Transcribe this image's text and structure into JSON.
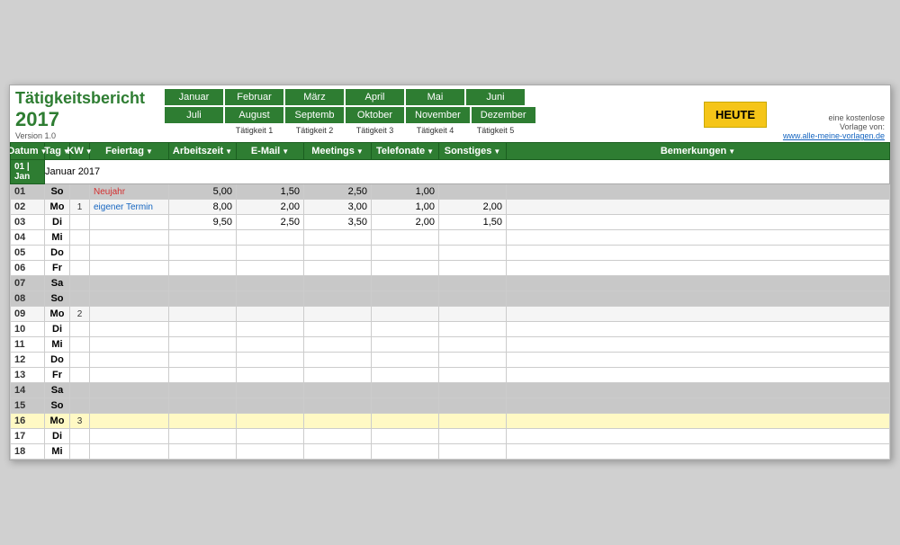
{
  "header": {
    "title": "Tätigkeitsbericht",
    "year": "2017",
    "version": "Version 1.0",
    "heute_label": "HEUTE",
    "right_line1": "eine kostenlose",
    "right_line2": "Vorlage von:",
    "right_link": "www.alle-meine-vorlagen.de"
  },
  "months_row1": [
    "Januar",
    "Februar",
    "März",
    "April",
    "Mai",
    "Juni"
  ],
  "months_row2": [
    "Juli",
    "August",
    "Septemb",
    "Oktober",
    "November",
    "Dezember"
  ],
  "taetigkeit_row1": [
    "Tätigkeit 1",
    "Tätigkeit 2",
    "Tätigkeit 3",
    "Tätigkeit 4",
    "Tätigkeit 5"
  ],
  "column_headers": {
    "datum": "Datum",
    "tag": "Tag",
    "kw": "KW",
    "feiertag": "Feiertag",
    "arbeitszeit": "Arbeitszeit",
    "email": "E-Mail",
    "meetings": "Meetings",
    "telefonate": "Telefonate",
    "sonstiges": "Sonstiges",
    "bemerkungen": "Bemerkungen"
  },
  "month_title": "Januar 2017",
  "month_prefix": "01 | Jan",
  "rows": [
    {
      "datum": "01",
      "tag": "So",
      "kw": "",
      "feiertag": "Neujahr",
      "feiertag_type": "holiday",
      "arbeitszeit": "5,00",
      "email": "1,50",
      "meetings": "2,50",
      "telefonate": "1,00",
      "sonstiges": "",
      "bemerkungen": "",
      "row_type": "weekend"
    },
    {
      "datum": "02",
      "tag": "Mo",
      "kw": "1",
      "feiertag": "eigener Termin",
      "feiertag_type": "eigener",
      "arbeitszeit": "8,00",
      "email": "2,00",
      "meetings": "3,00",
      "telefonate": "1,00",
      "sonstiges": "2,00",
      "bemerkungen": "",
      "row_type": "kw"
    },
    {
      "datum": "03",
      "tag": "Di",
      "kw": "",
      "feiertag": "",
      "feiertag_type": "",
      "arbeitszeit": "9,50",
      "email": "2,50",
      "meetings": "3,50",
      "telefonate": "2,00",
      "sonstiges": "1,50",
      "bemerkungen": "",
      "row_type": "weekday"
    },
    {
      "datum": "04",
      "tag": "Mi",
      "kw": "",
      "feiertag": "",
      "feiertag_type": "",
      "arbeitszeit": "",
      "email": "",
      "meetings": "",
      "telefonate": "",
      "sonstiges": "",
      "bemerkungen": "",
      "row_type": "weekday"
    },
    {
      "datum": "05",
      "tag": "Do",
      "kw": "",
      "feiertag": "",
      "feiertag_type": "",
      "arbeitszeit": "",
      "email": "",
      "meetings": "",
      "telefonate": "",
      "sonstiges": "",
      "bemerkungen": "",
      "row_type": "weekday"
    },
    {
      "datum": "06",
      "tag": "Fr",
      "kw": "",
      "feiertag": "",
      "feiertag_type": "",
      "arbeitszeit": "",
      "email": "",
      "meetings": "",
      "telefonate": "",
      "sonstiges": "",
      "bemerkungen": "",
      "row_type": "weekday"
    },
    {
      "datum": "07",
      "tag": "Sa",
      "kw": "",
      "feiertag": "",
      "feiertag_type": "",
      "arbeitszeit": "",
      "email": "",
      "meetings": "",
      "telefonate": "",
      "sonstiges": "",
      "bemerkungen": "",
      "row_type": "weekend"
    },
    {
      "datum": "08",
      "tag": "So",
      "kw": "",
      "feiertag": "",
      "feiertag_type": "",
      "arbeitszeit": "",
      "email": "",
      "meetings": "",
      "telefonate": "",
      "sonstiges": "",
      "bemerkungen": "",
      "row_type": "weekend"
    },
    {
      "datum": "09",
      "tag": "Mo",
      "kw": "2",
      "feiertag": "",
      "feiertag_type": "",
      "arbeitszeit": "",
      "email": "",
      "meetings": "",
      "telefonate": "",
      "sonstiges": "",
      "bemerkungen": "",
      "row_type": "kw"
    },
    {
      "datum": "10",
      "tag": "Di",
      "kw": "",
      "feiertag": "",
      "feiertag_type": "",
      "arbeitszeit": "",
      "email": "",
      "meetings": "",
      "telefonate": "",
      "sonstiges": "",
      "bemerkungen": "",
      "row_type": "weekday"
    },
    {
      "datum": "11",
      "tag": "Mi",
      "kw": "",
      "feiertag": "",
      "feiertag_type": "",
      "arbeitszeit": "",
      "email": "",
      "meetings": "",
      "telefonate": "",
      "sonstiges": "",
      "bemerkungen": "",
      "row_type": "weekday"
    },
    {
      "datum": "12",
      "tag": "Do",
      "kw": "",
      "feiertag": "",
      "feiertag_type": "",
      "arbeitszeit": "",
      "email": "",
      "meetings": "",
      "telefonate": "",
      "sonstiges": "",
      "bemerkungen": "",
      "row_type": "weekday"
    },
    {
      "datum": "13",
      "tag": "Fr",
      "kw": "",
      "feiertag": "",
      "feiertag_type": "",
      "arbeitszeit": "",
      "email": "",
      "meetings": "",
      "telefonate": "",
      "sonstiges": "",
      "bemerkungen": "",
      "row_type": "weekday"
    },
    {
      "datum": "14",
      "tag": "Sa",
      "kw": "",
      "feiertag": "",
      "feiertag_type": "",
      "arbeitszeit": "",
      "email": "",
      "meetings": "",
      "telefonate": "",
      "sonstiges": "",
      "bemerkungen": "",
      "row_type": "weekend"
    },
    {
      "datum": "15",
      "tag": "So",
      "kw": "",
      "feiertag": "",
      "feiertag_type": "",
      "arbeitszeit": "",
      "email": "",
      "meetings": "",
      "telefonate": "",
      "sonstiges": "",
      "bemerkungen": "",
      "row_type": "weekend"
    },
    {
      "datum": "16",
      "tag": "Mo",
      "kw": "3",
      "feiertag": "",
      "feiertag_type": "",
      "arbeitszeit": "",
      "email": "",
      "meetings": "",
      "telefonate": "",
      "sonstiges": "",
      "bemerkungen": "",
      "row_type": "kw16"
    },
    {
      "datum": "17",
      "tag": "Di",
      "kw": "",
      "feiertag": "",
      "feiertag_type": "",
      "arbeitszeit": "",
      "email": "",
      "meetings": "",
      "telefonate": "",
      "sonstiges": "",
      "bemerkungen": "",
      "row_type": "weekday"
    },
    {
      "datum": "18",
      "tag": "Mi",
      "kw": "",
      "feiertag": "",
      "feiertag_type": "",
      "arbeitszeit": "",
      "email": "",
      "meetings": "",
      "telefonate": "",
      "sonstiges": "",
      "bemerkungen": "",
      "row_type": "weekday"
    }
  ]
}
